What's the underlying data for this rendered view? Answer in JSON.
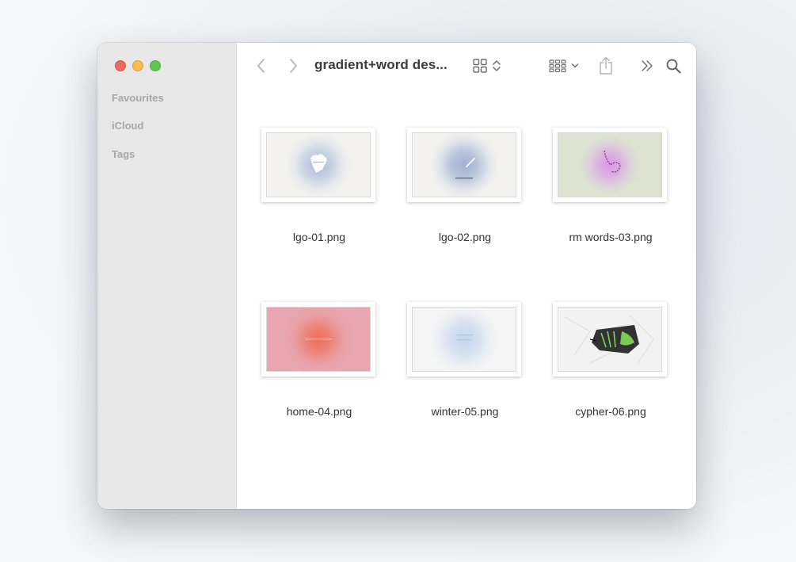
{
  "window": {
    "title": "gradient+word des...",
    "controls": [
      "close",
      "minimize",
      "zoom"
    ]
  },
  "sidebar": {
    "sections": [
      {
        "label": "Favourites"
      },
      {
        "label": "iCloud"
      },
      {
        "label": "Tags"
      }
    ]
  },
  "toolbar": {
    "back_icon": "chevron-left-icon",
    "forward_icon": "chevron-right-icon",
    "view_icon": "grid-view-icon",
    "group_icon": "group-by-icon",
    "share_icon": "share-icon",
    "more_icon": "double-chevron-right-icon",
    "search_icon": "search-icon"
  },
  "files": [
    {
      "name": "lgo-01.png",
      "bg": "#f3f2ee",
      "glow": "#aebbd6"
    },
    {
      "name": "lgo-02.png",
      "bg": "#f3f2ee",
      "glow": "#9fb0d3"
    },
    {
      "name": "rm words-03.png",
      "bg": "#dde3d0",
      "glow": "#d99ae6"
    },
    {
      "name": "home-04.png",
      "bg": "#e8a6b0",
      "glow": "#ec6a52"
    },
    {
      "name": "winter-05.png",
      "bg": "#f5f5f5",
      "glow": "#c6d6ee"
    },
    {
      "name": "cypher-06.png",
      "bg": "#f2f2f2",
      "glow": "#7fd15a"
    }
  ],
  "colors": {
    "close": "#ed6a5e",
    "minimize": "#f5bf4f",
    "zoom": "#61c554"
  }
}
